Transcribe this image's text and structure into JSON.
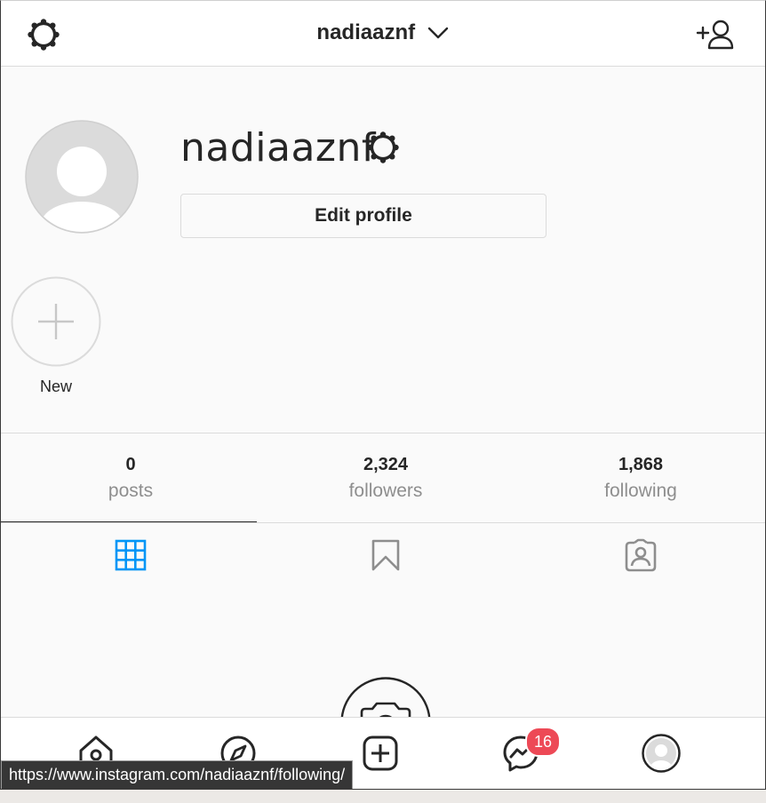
{
  "header": {
    "title": "nadiaaznf"
  },
  "profile": {
    "username": "nadiaaznf",
    "edit_label": "Edit profile"
  },
  "highlights": {
    "new_label": "New"
  },
  "stats": [
    {
      "value": "0",
      "label": "posts"
    },
    {
      "value": "2,324",
      "label": "followers"
    },
    {
      "value": "1,868",
      "label": "following"
    }
  ],
  "tabs": {
    "active_color": "#0095f6",
    "inactive_color": "#8e8e8e"
  },
  "bottom_nav": {
    "messenger_badge": "16",
    "badge_color": "#ed4956"
  },
  "status_bar": {
    "url": "https://www.instagram.com/nadiaaznf/following/"
  }
}
